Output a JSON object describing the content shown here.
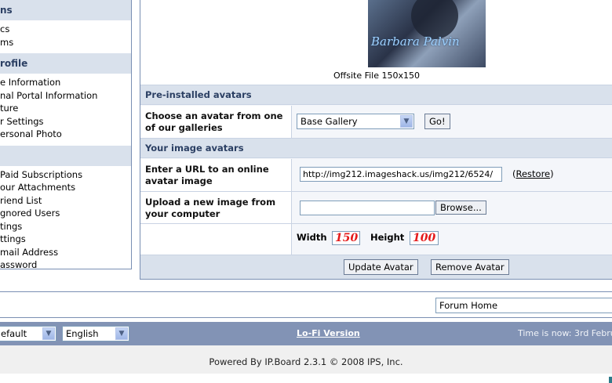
{
  "sidebar": {
    "sections": [
      {
        "heading": "ns",
        "items": [
          "cs",
          "ms"
        ]
      },
      {
        "heading": "rofile",
        "items": [
          "e Information",
          "nal Portal Information",
          "ture",
          "r Settings",
          "ersonal Photo"
        ]
      },
      {
        "heading": "",
        "items": [
          "Paid Subscriptions",
          "our Attachments",
          "riend List",
          "gnored Users",
          "tings",
          "ttings",
          "mail Address",
          "assword"
        ]
      }
    ]
  },
  "preview": {
    "image_text": "Barbara Palvin",
    "caption": "Offsite File 150x150"
  },
  "preinstalled": {
    "heading": "Pre-installed avatars",
    "label": "Choose an avatar from one of our galleries",
    "gallery_value": "Base Gallery",
    "go_label": "Go!"
  },
  "image_avatars": {
    "heading": "Your image avatars",
    "url_label": "Enter a URL to an online avatar image",
    "url_value": "http://img212.imageshack.us/img212/6524/",
    "restore_label": "Restore",
    "upload_label": "Upload a new image from your computer",
    "upload_value": "",
    "browse_label": "Browse...",
    "width_label": "Width",
    "width_value": "150",
    "height_label": "Height",
    "height_value": "100"
  },
  "actions": {
    "update_label": "Update Avatar",
    "remove_label": "Remove Avatar"
  },
  "nav": {
    "jump_value": "Forum Home"
  },
  "footer": {
    "skin_value": "efault",
    "language_value": "English",
    "lofi_label": "Lo-Fi Version",
    "time_text": "Time is now: 3rd Febru",
    "powered_text": "Powered By IP.Board 2.3.1 © 2008  IPS, Inc."
  }
}
